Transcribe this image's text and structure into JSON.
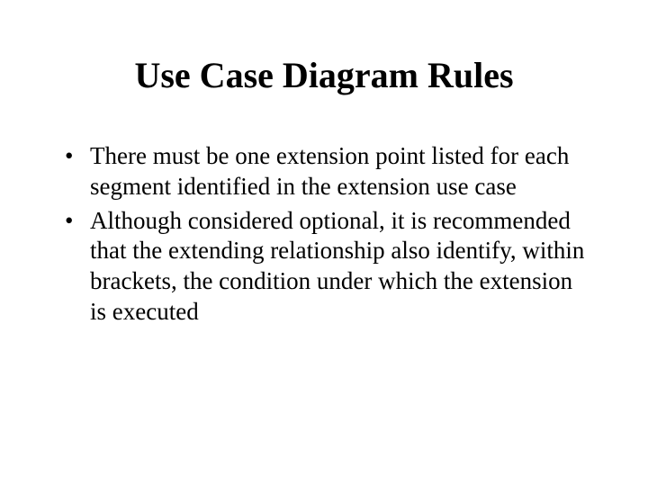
{
  "title": "Use Case Diagram Rules",
  "bullets": [
    "There must be one extension point listed for each segment identified in the extension use case",
    "Although considered optional, it is recommended that the extending relationship also identify, within brackets, the condition under which the extension is executed"
  ]
}
